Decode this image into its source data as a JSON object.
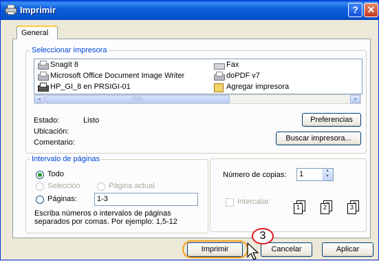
{
  "window": {
    "title": "Imprimir",
    "help": "?",
    "close": "✕"
  },
  "tabs": [
    "General"
  ],
  "printer_group": {
    "legend": "Seleccionar impresora",
    "printers": [
      {
        "name": "SnagIt 8",
        "icon": "printer-icon"
      },
      {
        "name": "Microsoft Office Document Image Writer",
        "icon": "printer-icon"
      },
      {
        "name": "HP_GI_8 en PRSIGI-01",
        "icon": "network-printer-icon"
      },
      {
        "name": "Fax",
        "icon": "fax-icon"
      },
      {
        "name": "doPDF v7",
        "icon": "printer-icon"
      },
      {
        "name": "Agregar impresora",
        "icon": "add-printer-icon"
      }
    ],
    "scroll_left": "<",
    "scroll_right": ">",
    "scroll_grip": "IIIII",
    "status_label": "Estado:",
    "status_value": "Listo",
    "location_label": "Ubicación:",
    "comment_label": "Comentario:",
    "preferences_button": "Preferencias",
    "find_printer_button": "Buscar impresora..."
  },
  "range_group": {
    "legend": "Intervalo de páginas",
    "all": "Todo",
    "selection": "Selección",
    "current_page": "Página actual",
    "pages": "Páginas:",
    "pages_value": "1-3",
    "hint": "Escriba números o intervalos de páginas separados por comas. Por ejemplo: 1,5-12",
    "selected": "all"
  },
  "copies_group": {
    "copies_label": "Número de copias:",
    "copies_value": "1",
    "collate_label": "Intercalar",
    "collate_checked": false,
    "page_labels": [
      "1",
      "1",
      "2",
      "2",
      "3",
      "3"
    ]
  },
  "footer": {
    "print_button": "Imprimir",
    "cancel_button": "Cancelar",
    "apply_button": "Aplicar"
  },
  "annotation": {
    "step": "3"
  },
  "colors": {
    "titlebar": "#0654d0",
    "accent": "#f39a1c",
    "badge": "#e0161d",
    "legend": "#0046d5"
  }
}
